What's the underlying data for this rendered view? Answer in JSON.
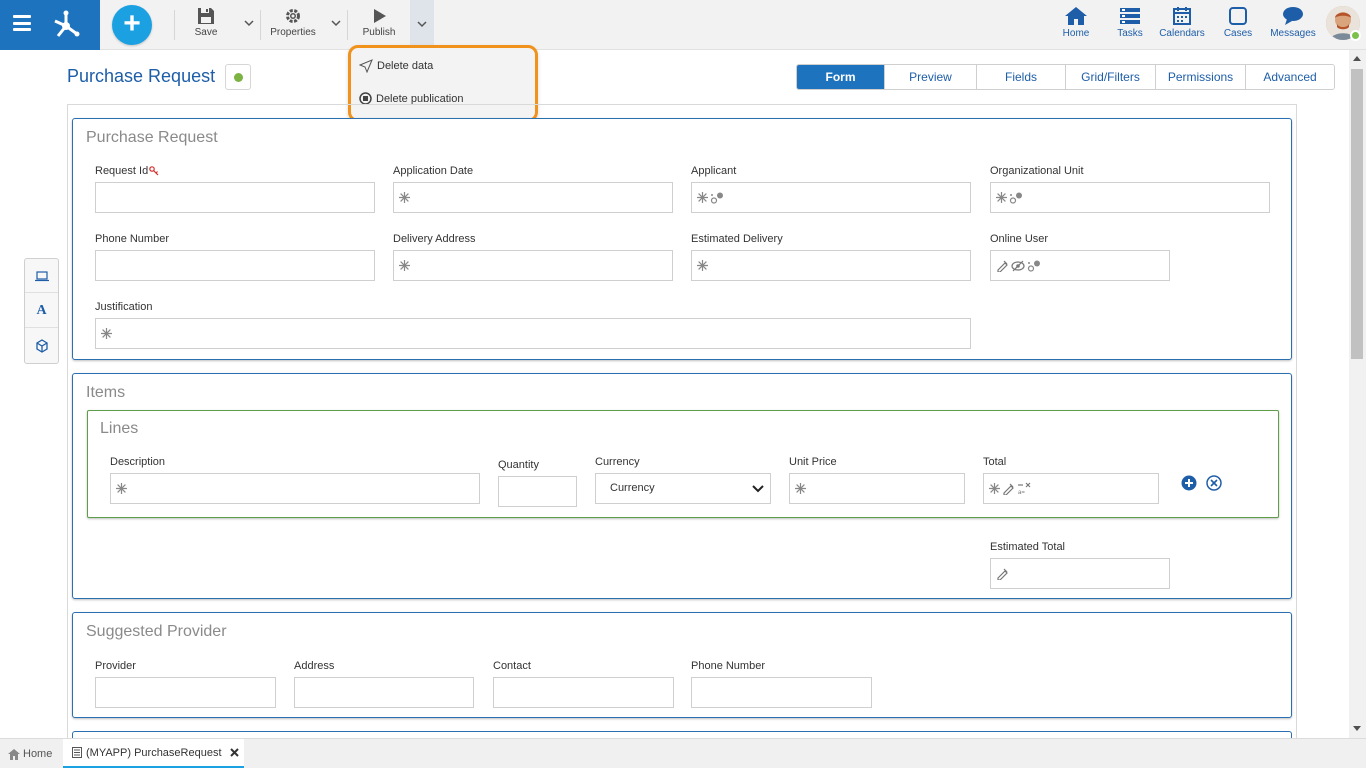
{
  "toolbar": {
    "save_label": "Save",
    "properties_label": "Properties",
    "publish_label": "Publish"
  },
  "publish_menu": {
    "items": [
      "Delete data",
      "Delete publication"
    ]
  },
  "nav": {
    "home": "Home",
    "tasks": "Tasks",
    "calendars": "Calendars",
    "cases": "Cases",
    "messages": "Messages"
  },
  "page": {
    "title": "Purchase Request"
  },
  "tabs": [
    "Form",
    "Preview",
    "Fields",
    "Grid/Filters",
    "Permissions",
    "Advanced"
  ],
  "form": {
    "purchase_request": {
      "title": "Purchase Request",
      "fields": {
        "request_id": "Request Id",
        "application_date": "Application Date",
        "applicant": "Applicant",
        "organizational_unit": "Organizational Unit",
        "phone_number": "Phone Number",
        "delivery_address": "Delivery Address",
        "estimated_delivery": "Estimated Delivery",
        "online_user": "Online User",
        "justification": "Justification"
      }
    },
    "items": {
      "title": "Items",
      "lines": {
        "title": "Lines",
        "fields": {
          "description": "Description",
          "quantity": "Quantity",
          "currency": "Currency",
          "currency_value": "Currency",
          "unit_price": "Unit Price",
          "total": "Total"
        }
      },
      "estimated_total": "Estimated Total"
    },
    "suggested_provider": {
      "title": "Suggested Provider",
      "fields": {
        "provider": "Provider",
        "address": "Address",
        "contact": "Contact",
        "phone_number": "Phone Number"
      }
    }
  },
  "bottom_tabs": {
    "home": "Home",
    "current": "(MYAPP) PurchaseRequest"
  },
  "colors": {
    "brand": "#1e73be",
    "accent": "#1ba1e2",
    "highlight": "#f0921c",
    "status": "#7cb342"
  }
}
